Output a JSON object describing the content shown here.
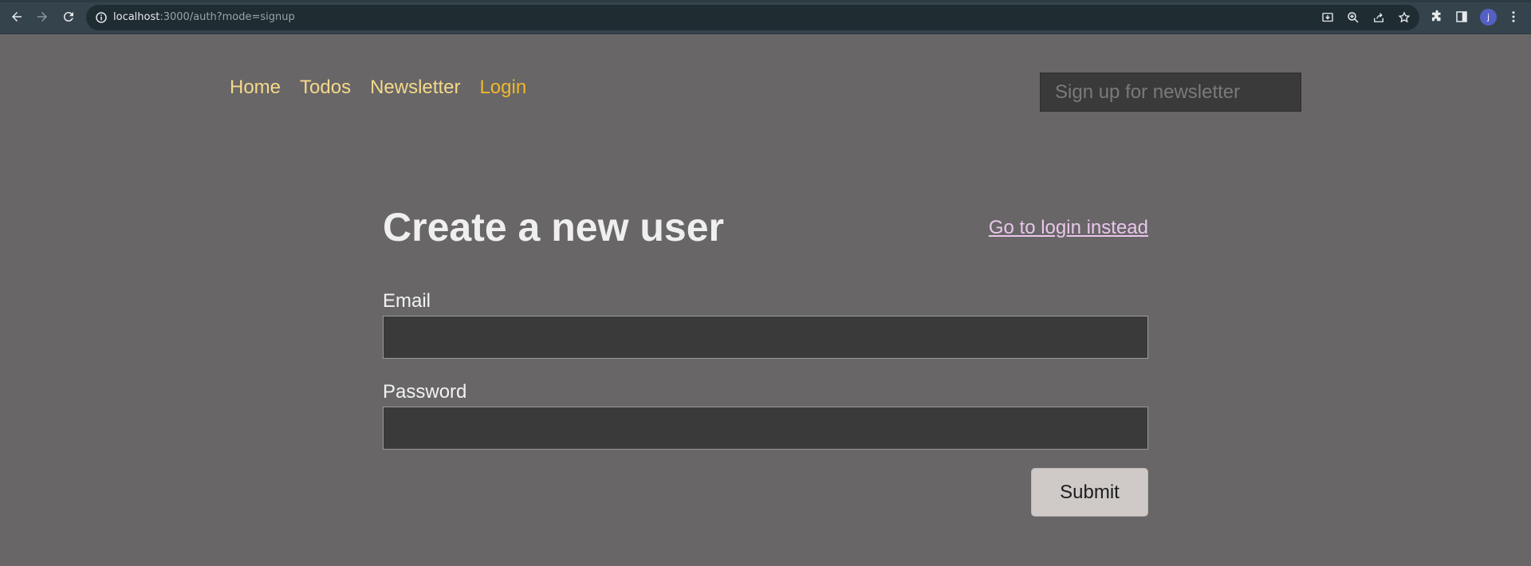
{
  "browser": {
    "url_host": "localhost",
    "url_rest": ":3000/auth?mode=signup",
    "avatar_letter": "j",
    "icons": [
      "back-arrow-icon",
      "forward-arrow-icon",
      "reload-icon",
      "info-icon",
      "install-icon",
      "zoom-icon",
      "share-icon",
      "star-icon",
      "extensions-icon",
      "sidepanel-icon",
      "menu-dots-icon"
    ]
  },
  "nav": {
    "home": "Home",
    "todos": "Todos",
    "newsletter": "Newsletter",
    "login": "Login"
  },
  "newsletter_input": {
    "placeholder": "Sign up for newsletter"
  },
  "form": {
    "title": "Create a new user",
    "toggle_link": "Go to login instead",
    "email_label": "Email",
    "password_label": "Password",
    "submit_label": "Submit"
  },
  "colors": {
    "page_bg": "#686667",
    "nav_link": "#f5d98a",
    "nav_active": "#f0b82a",
    "toggle_link": "#e9c6ec",
    "input_bg": "#3a3a3a",
    "submit_bg": "#cfcac8"
  }
}
